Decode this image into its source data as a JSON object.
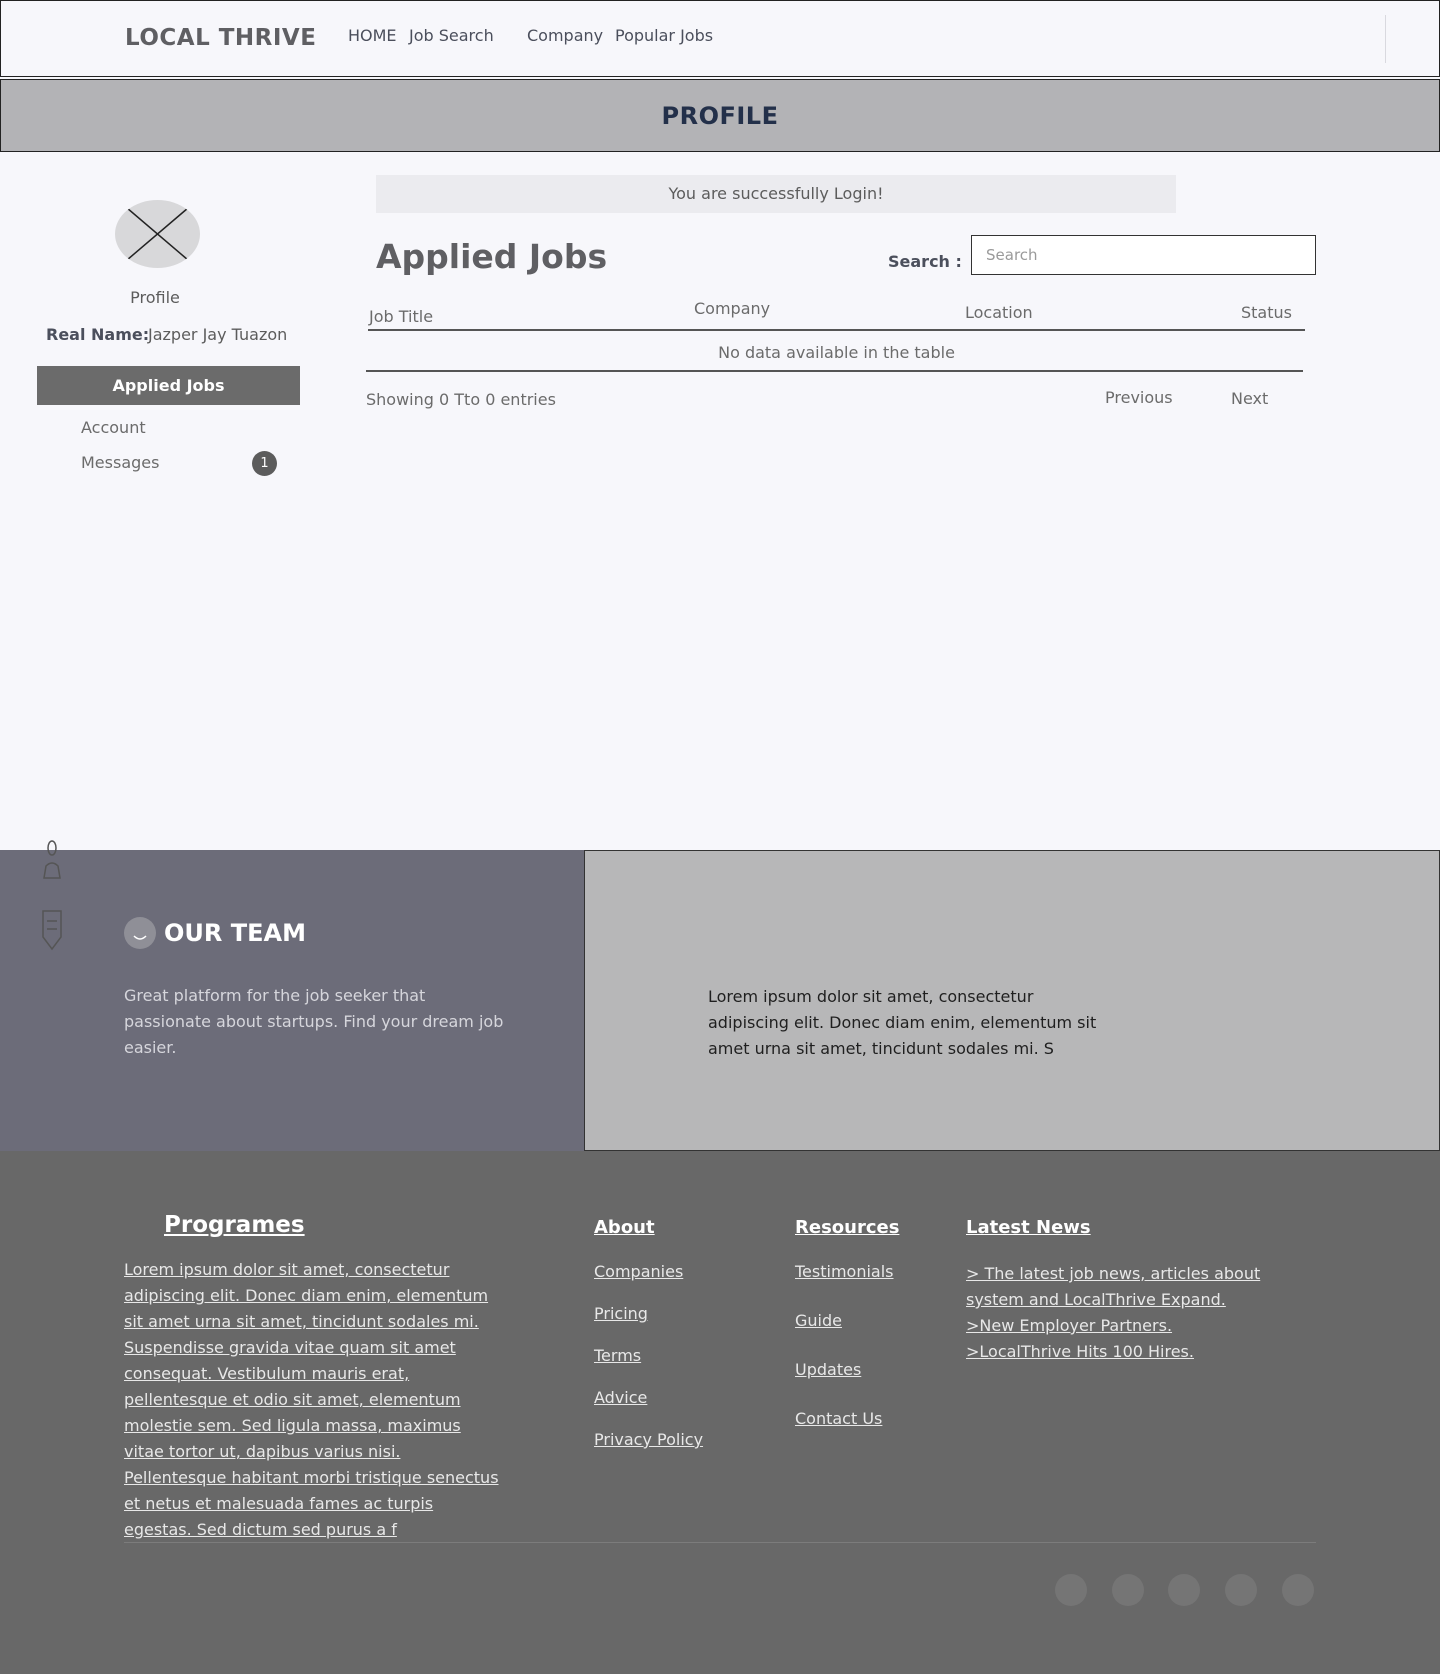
{
  "header": {
    "brand": "LOCAL THRIVE",
    "nav": [
      "HOME",
      "Job Search",
      "Company",
      "Popular Jobs"
    ]
  },
  "band": {
    "title": "PROFILE"
  },
  "sidebar": {
    "profile_caption": "Profile",
    "real_name_label": "Real Name:",
    "real_name_value": "Jazper Jay Tuazon",
    "items": [
      {
        "label": "Applied Jobs",
        "active": true
      },
      {
        "label": "Account"
      },
      {
        "label": "Messages",
        "badge": "1"
      }
    ]
  },
  "main": {
    "success_message": "You are successfully Login!",
    "title": "Applied Jobs",
    "search_label": "Search :",
    "search_placeholder": "Search",
    "columns": [
      "Job Title",
      "Company",
      "Location",
      "Status"
    ],
    "empty_text": "No data available in the table",
    "showing": "Showing 0 Tto 0 entries",
    "prev": "Previous",
    "next": "Next"
  },
  "team": {
    "title": "OUR TEAM",
    "description": "Great platform for the job seeker that passionate about startups. Find your dream job easier.",
    "quote": "Lorem ipsum dolor sit amet, consectetur adipiscing elit. Donec diam enim, elementum sit amet urna sit amet, tincidunt sodales mi. S"
  },
  "footer": {
    "programes_title": "Programes",
    "programes_text": "Lorem ipsum dolor sit amet, consectetur adipiscing elit. Donec diam enim, elementum sit amet urna sit amet, tincidunt sodales mi. Suspendisse gravida vitae quam sit amet consequat. Vestibulum mauris erat, pellentesque et odio sit amet, elementum molestie sem. Sed ligula massa, maximus vitae tortor ut, dapibus varius nisi. Pellentesque habitant morbi tristique senectus et netus et malesuada fames ac turpis egestas. Sed dictum sed purus a f",
    "about_title": "About",
    "about_links": [
      "Companies",
      "Pricing",
      "Terms",
      "Advice",
      "Privacy Policy"
    ],
    "resources_title": "Resources",
    "resources_links": [
      "Testimonials",
      "Guide",
      "Updates",
      "Contact Us"
    ],
    "news_title": "Latest News",
    "news_items": [
      "> The latest job news, articles about",
      "system and LocalThrive Expand.",
      ">New Employer Partners.",
      ">LocalThrive Hits 100 Hires."
    ]
  },
  "colors": {
    "band": "#b3b3b6",
    "active_side": "#6b6b6b",
    "team_left": "#6c6c79",
    "team_right": "#b7b7b8",
    "footer": "#686868"
  }
}
